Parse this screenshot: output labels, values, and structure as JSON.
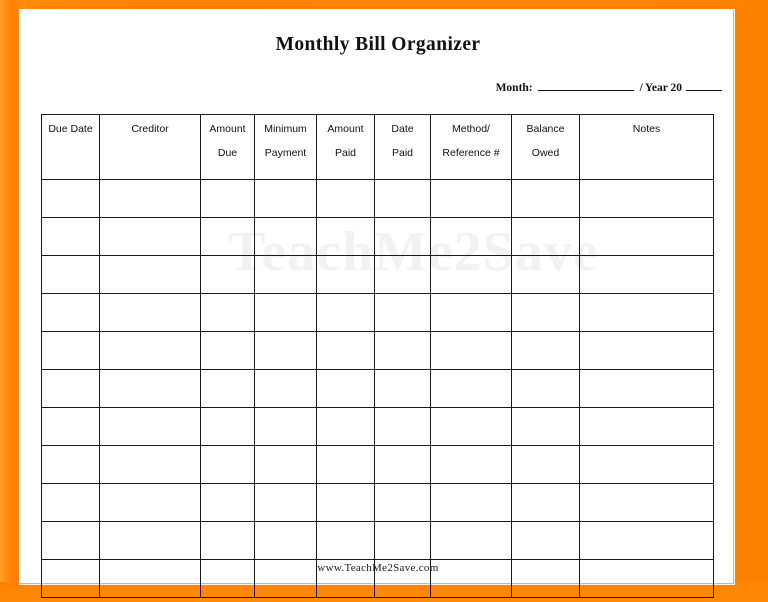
{
  "document": {
    "title": "Monthly Bill Organizer",
    "footer_url": "www.TeachMe2Save.com",
    "watermark_text": "TeachMe2Save"
  },
  "meta": {
    "month_label": "Month:",
    "month_value": "",
    "separator": "/",
    "year_label": "Year 20",
    "year_value": ""
  },
  "table": {
    "columns": [
      {
        "line1": "Due Date",
        "line2": ""
      },
      {
        "line1": "Creditor",
        "line2": ""
      },
      {
        "line1": "Amount",
        "line2": "Due"
      },
      {
        "line1": "Minimum",
        "line2": "Payment"
      },
      {
        "line1": "Amount",
        "line2": "Paid"
      },
      {
        "line1": "Date",
        "line2": "Paid"
      },
      {
        "line1": "Method/",
        "line2": "Reference #"
      },
      {
        "line1": "Balance",
        "line2": "Owed"
      },
      {
        "line1": "Notes",
        "line2": ""
      }
    ],
    "row_count": 11,
    "rows": [
      [
        "",
        "",
        "",
        "",
        "",
        "",
        "",
        "",
        ""
      ],
      [
        "",
        "",
        "",
        "",
        "",
        "",
        "",
        "",
        ""
      ],
      [
        "",
        "",
        "",
        "",
        "",
        "",
        "",
        "",
        ""
      ],
      [
        "",
        "",
        "",
        "",
        "",
        "",
        "",
        "",
        ""
      ],
      [
        "",
        "",
        "",
        "",
        "",
        "",
        "",
        "",
        ""
      ],
      [
        "",
        "",
        "",
        "",
        "",
        "",
        "",
        "",
        ""
      ],
      [
        "",
        "",
        "",
        "",
        "",
        "",
        "",
        "",
        ""
      ],
      [
        "",
        "",
        "",
        "",
        "",
        "",
        "",
        "",
        ""
      ],
      [
        "",
        "",
        "",
        "",
        "",
        "",
        "",
        "",
        ""
      ],
      [
        "",
        "",
        "",
        "",
        "",
        "",
        "",
        "",
        ""
      ],
      [
        "",
        "",
        "",
        "",
        "",
        "",
        "",
        "",
        ""
      ]
    ]
  },
  "colors": {
    "border_orange": "#FF8000",
    "page_white": "#FFFFFF",
    "table_line": "#1A1A1A",
    "text": "#111111"
  }
}
